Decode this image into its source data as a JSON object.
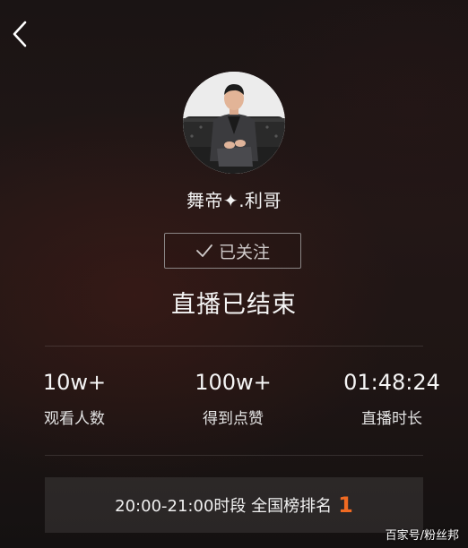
{
  "header": {
    "back_icon": "chevron-left-icon"
  },
  "host": {
    "name": "舞帝✦.利哥",
    "avatar_icon": "host-avatar"
  },
  "follow": {
    "label": "已关注",
    "icon": "check-icon"
  },
  "status": {
    "ended_text": "直播已结束"
  },
  "stats": [
    {
      "value": "10w+",
      "label": "观看人数"
    },
    {
      "value": "100w+",
      "label": "得到点赞"
    },
    {
      "value": "01:48:24",
      "label": "直播时长"
    }
  ],
  "ranking": {
    "text": "20:00-21:00时段 全国榜排名",
    "rank": "1",
    "rank_color": "#f06a22"
  },
  "watermark": {
    "text": "百家号/粉丝邦"
  },
  "colors": {
    "background": "#1e1514",
    "accent": "#f06a22"
  }
}
